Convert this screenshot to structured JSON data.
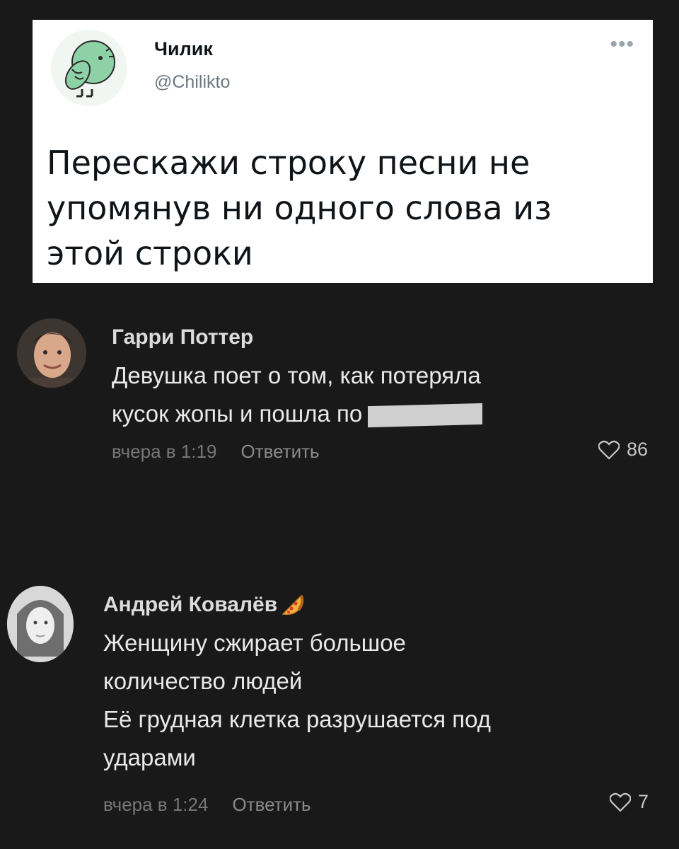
{
  "tweet": {
    "name": "Чилик",
    "handle": "@Chilikto",
    "more": "•••",
    "text": "Перескажи строку песни не упомянув ни одного слова из этой строки",
    "text_lines": [
      "Перескажи строку песни не",
      "упомянув ни одного слова из",
      "этой строки"
    ]
  },
  "comments": [
    {
      "author": "Гарри Поттер",
      "lines": [
        "Девушка поет о том, как потеряла",
        "кусок жопы и пошла по"
      ],
      "time": "вчера в 1:19",
      "reply": "Ответить",
      "likes": "86"
    },
    {
      "author": "Андрей Ковалёв",
      "badge": "pizza-icon",
      "lines": [
        "Женщину сжирает большое",
        "количество людей",
        "Её грудная клетка разрушается под",
        "ударами"
      ],
      "time": "вчера в 1:24",
      "reply": "Ответить",
      "likes": "7"
    }
  ],
  "colors": {
    "background": "#19191a",
    "card": "#ffffff",
    "meta": "#777777"
  }
}
